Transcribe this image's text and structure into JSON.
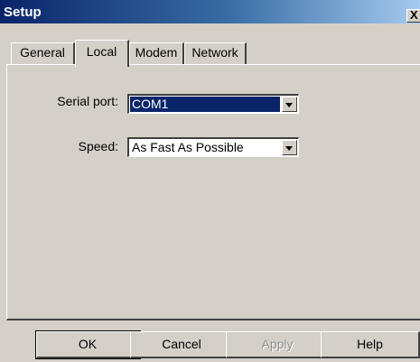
{
  "window": {
    "title": "Setup",
    "close_glyph": "X"
  },
  "tabs": [
    {
      "label": "General",
      "active": false
    },
    {
      "label": "Local",
      "active": true
    },
    {
      "label": "Modem",
      "active": false
    },
    {
      "label": "Network",
      "active": false
    }
  ],
  "fields": {
    "serial_port": {
      "label": "Serial port:",
      "value": "COM1"
    },
    "speed": {
      "label": "Speed:",
      "value": "As Fast As Possible"
    }
  },
  "buttons": {
    "ok": "OK",
    "cancel": "Cancel",
    "apply": "Apply",
    "help": "Help"
  },
  "colors": {
    "title_bar": "#0a246a",
    "selection": "#0a246a",
    "face": "#d4d0c8"
  }
}
